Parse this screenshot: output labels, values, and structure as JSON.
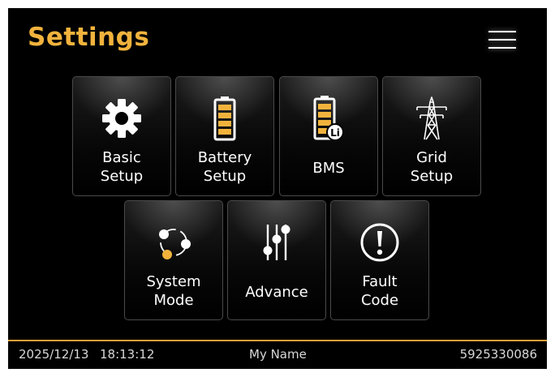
{
  "header": {
    "title": "Settings"
  },
  "tiles": [
    {
      "icon": "gear-icon",
      "line1": "Basic",
      "line2": "Setup"
    },
    {
      "icon": "battery-icon",
      "line1": "Battery",
      "line2": "Setup"
    },
    {
      "icon": "battery-lithium-icon",
      "line1": "BMS",
      "badge": "Li"
    },
    {
      "icon": "transmission-tower-icon",
      "line1": "Grid",
      "line2": "Setup"
    },
    {
      "icon": "system-mode-icon",
      "line1": "System",
      "line2": "Mode"
    },
    {
      "icon": "sliders-icon",
      "line1": "Advance"
    },
    {
      "icon": "alert-circle-icon",
      "line1": "Fault",
      "line2": "Code"
    }
  ],
  "footer": {
    "date": "2025/12/13",
    "time": "18:13:12",
    "user": "My Name",
    "serial": "5925330086"
  },
  "colors": {
    "accent": "#f2b33d",
    "footer_line": "#e6a035",
    "background": "#000000"
  }
}
